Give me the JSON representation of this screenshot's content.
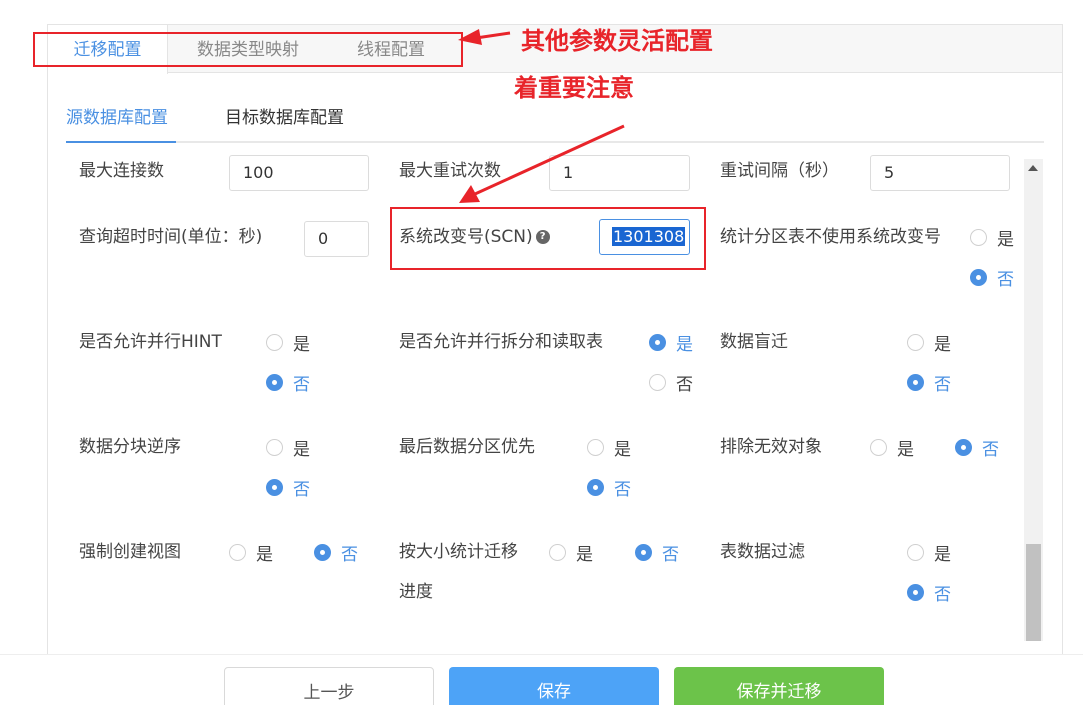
{
  "top_tabs": [
    "迁移配置",
    "数据类型映射",
    "线程配置"
  ],
  "sub_tabs": [
    "源数据库配置",
    "目标数据库配置"
  ],
  "fields": {
    "max_conn_label": "最大连接数",
    "max_conn_value": "100",
    "max_retry_label": "最大重试次数",
    "max_retry_value": "1",
    "retry_interval_label": "重试间隔（秒）",
    "retry_interval_value": "5",
    "query_timeout_label": "查询超时时间(单位：秒)",
    "query_timeout_value": "0",
    "scn_label": "系统改变号(SCN)",
    "scn_value": "1301308",
    "stat_partition_label": "统计分区表不使用系统改变号",
    "parallel_hint_label": "是否允许并行HINT",
    "parallel_split_label": "是否允许并行拆分和读取表",
    "blind_migrate_label": "数据盲迁",
    "block_reverse_label": "数据分块逆序",
    "last_partition_label": "最后数据分区优先",
    "exclude_invalid_label": "排除无效对象",
    "force_view_label": "强制创建视图",
    "size_progress_label": "按大小统计迁移",
    "size_progress_label2": "进度",
    "table_filter_label": "表数据过滤"
  },
  "yes": "是",
  "no": "否",
  "help_glyph": "?",
  "buttons": {
    "prev": "上一步",
    "save": "保存",
    "save_migrate": "保存并迁移"
  },
  "annotations": {
    "flexible_config": "其他参数灵活配置",
    "note_important": "着重要注意"
  },
  "colors": {
    "accent": "#4a90e2",
    "save": "#4da3f7",
    "save_migrate": "#6cc34a",
    "annotation": "#e8242a"
  }
}
